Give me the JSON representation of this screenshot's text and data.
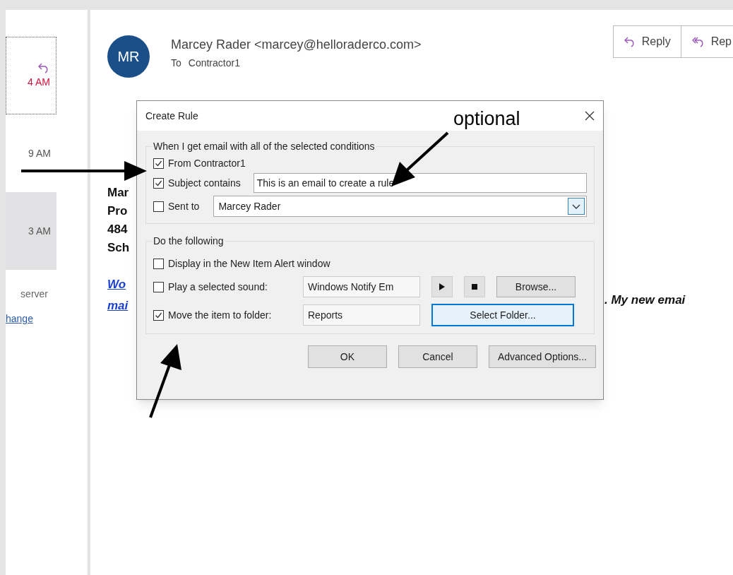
{
  "message_list": {
    "items": [
      {
        "time": "4 AM",
        "replied": true,
        "focused": true,
        "selected": false
      },
      {
        "time": "9 AM",
        "replied": false,
        "focused": false,
        "selected": false
      },
      {
        "time": "3 AM",
        "replied": false,
        "focused": false,
        "selected": true
      }
    ],
    "note": "server",
    "link": "hange"
  },
  "message": {
    "avatar": "MR",
    "sender": "Marcey Rader <marcey@helloraderco.com>",
    "to_label": "To",
    "to": "Contractor1",
    "actions": [
      {
        "kind": "reply",
        "label": "Reply"
      },
      {
        "kind": "reply_all",
        "label": "Rep"
      }
    ],
    "body_lines": [
      "Mar",
      "Pro",
      "484",
      "Sch"
    ],
    "links": [
      "Wo",
      "mai"
    ],
    "body_tail": ". My new emai"
  },
  "dialog": {
    "title": "Create Rule",
    "conditions": {
      "legend": "When I get email with all of the selected conditions",
      "rows": [
        {
          "kind": "plain",
          "label": "From Contractor1",
          "checked": true
        },
        {
          "kind": "text",
          "label": "Subject contains",
          "checked": true,
          "value": "This is an email to create a rule"
        },
        {
          "kind": "combo",
          "label": "Sent to",
          "checked": false,
          "value": "Marcey Rader"
        }
      ]
    },
    "actions": {
      "legend": "Do the following",
      "rows": [
        {
          "kind": "plain",
          "label": "Display in the New Item Alert window",
          "checked": false
        },
        {
          "kind": "sound",
          "label": "Play a selected sound:",
          "checked": false,
          "value": "Windows Notify Em",
          "button": "Browse..."
        },
        {
          "kind": "folder",
          "label": "Move the item to folder:",
          "checked": true,
          "value": "Reports",
          "button": "Select Folder..."
        }
      ]
    },
    "buttons": [
      "OK",
      "Cancel",
      "Advanced Options..."
    ]
  },
  "annotation": {
    "label": "optional"
  }
}
